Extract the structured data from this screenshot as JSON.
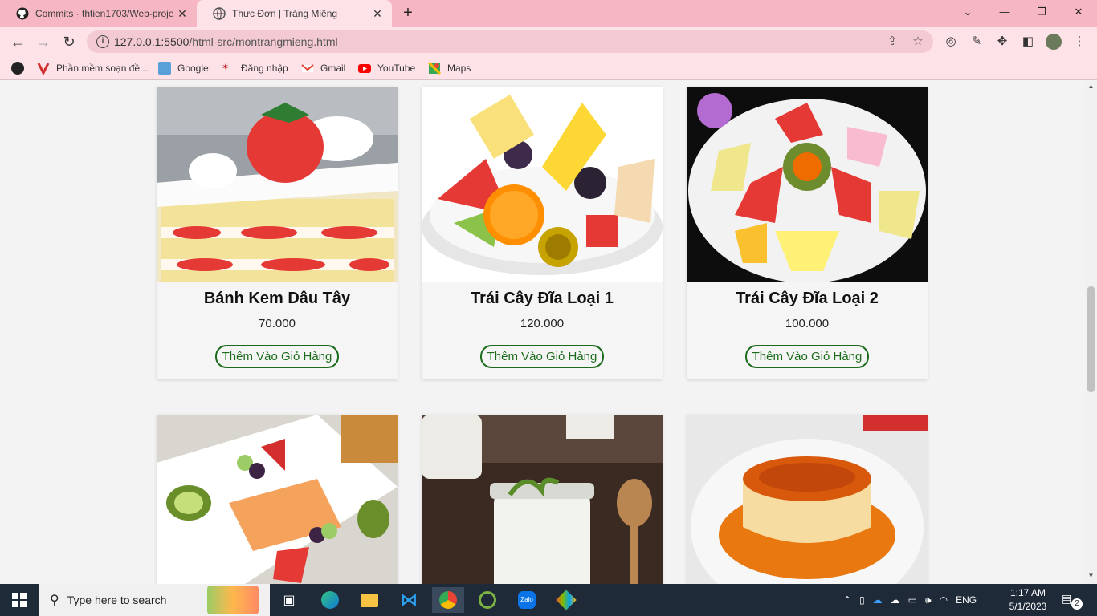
{
  "browser": {
    "tabs": [
      {
        "title": "Commits · thtien1703/Web-proje",
        "icon": "github-icon"
      },
      {
        "title": "Thực Đơn | Tráng Miệng",
        "icon": "globe-icon"
      }
    ],
    "url_host": "127.0.0.1:5500",
    "url_path": "/html-src/montrangmieng.html",
    "bookmarks": [
      {
        "label": "Phần mềm soạn đề...",
        "icon": "v-logo-icon"
      },
      {
        "label": "Google",
        "icon": "google-icon"
      },
      {
        "label": "Đăng nhập",
        "icon": "login-icon"
      },
      {
        "label": "Gmail",
        "icon": "gmail-icon"
      },
      {
        "label": "YouTube",
        "icon": "youtube-icon"
      },
      {
        "label": "Maps",
        "icon": "maps-icon"
      }
    ]
  },
  "products": [
    {
      "name": "Bánh Kem Dâu Tây",
      "price": "70.000",
      "button": "Thêm Vào Giỏ Hàng"
    },
    {
      "name": "Trái Cây Đĩa Loại 1",
      "price": "120.000",
      "button": "Thêm Vào Giỏ Hàng"
    },
    {
      "name": "Trái Cây Đĩa Loại 2",
      "price": "100.000",
      "button": "Thêm Vào Giỏ Hàng"
    }
  ],
  "products_row2": [
    {
      "image": "fruit-platter-image"
    },
    {
      "image": "yogurt-jar-image"
    },
    {
      "image": "flan-caramel-image"
    }
  ],
  "taskbar": {
    "search_placeholder": "Type here to search",
    "language": "ENG",
    "time": "1:17 AM",
    "date": "5/1/2023",
    "notification_count": "2"
  },
  "colors": {
    "tab_strip": "#f7b6c3",
    "toolbar": "#fde2e7",
    "button_green": "#1b6b1b",
    "taskbar": "#1e2a38"
  }
}
